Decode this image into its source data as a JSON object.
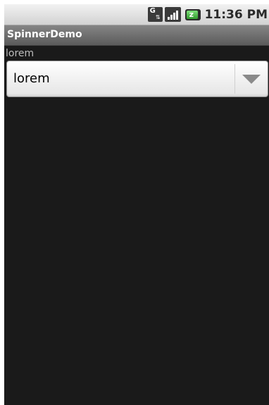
{
  "status_bar": {
    "time": "11:36 PM",
    "icons": [
      "sim-data-icon",
      "signal-icon",
      "battery-charging-icon"
    ]
  },
  "app": {
    "title": "SpinnerDemo"
  },
  "main": {
    "selection_label": "lorem",
    "spinner": {
      "selected_value": "lorem"
    }
  },
  "colors": {
    "background": "#1a1a1a",
    "title_bar": "#6e6e6e",
    "status_bar": "#e4e4e4",
    "label_text": "#bdbdbd",
    "spinner_bg": "#ffffff",
    "battery": "#3db038"
  }
}
